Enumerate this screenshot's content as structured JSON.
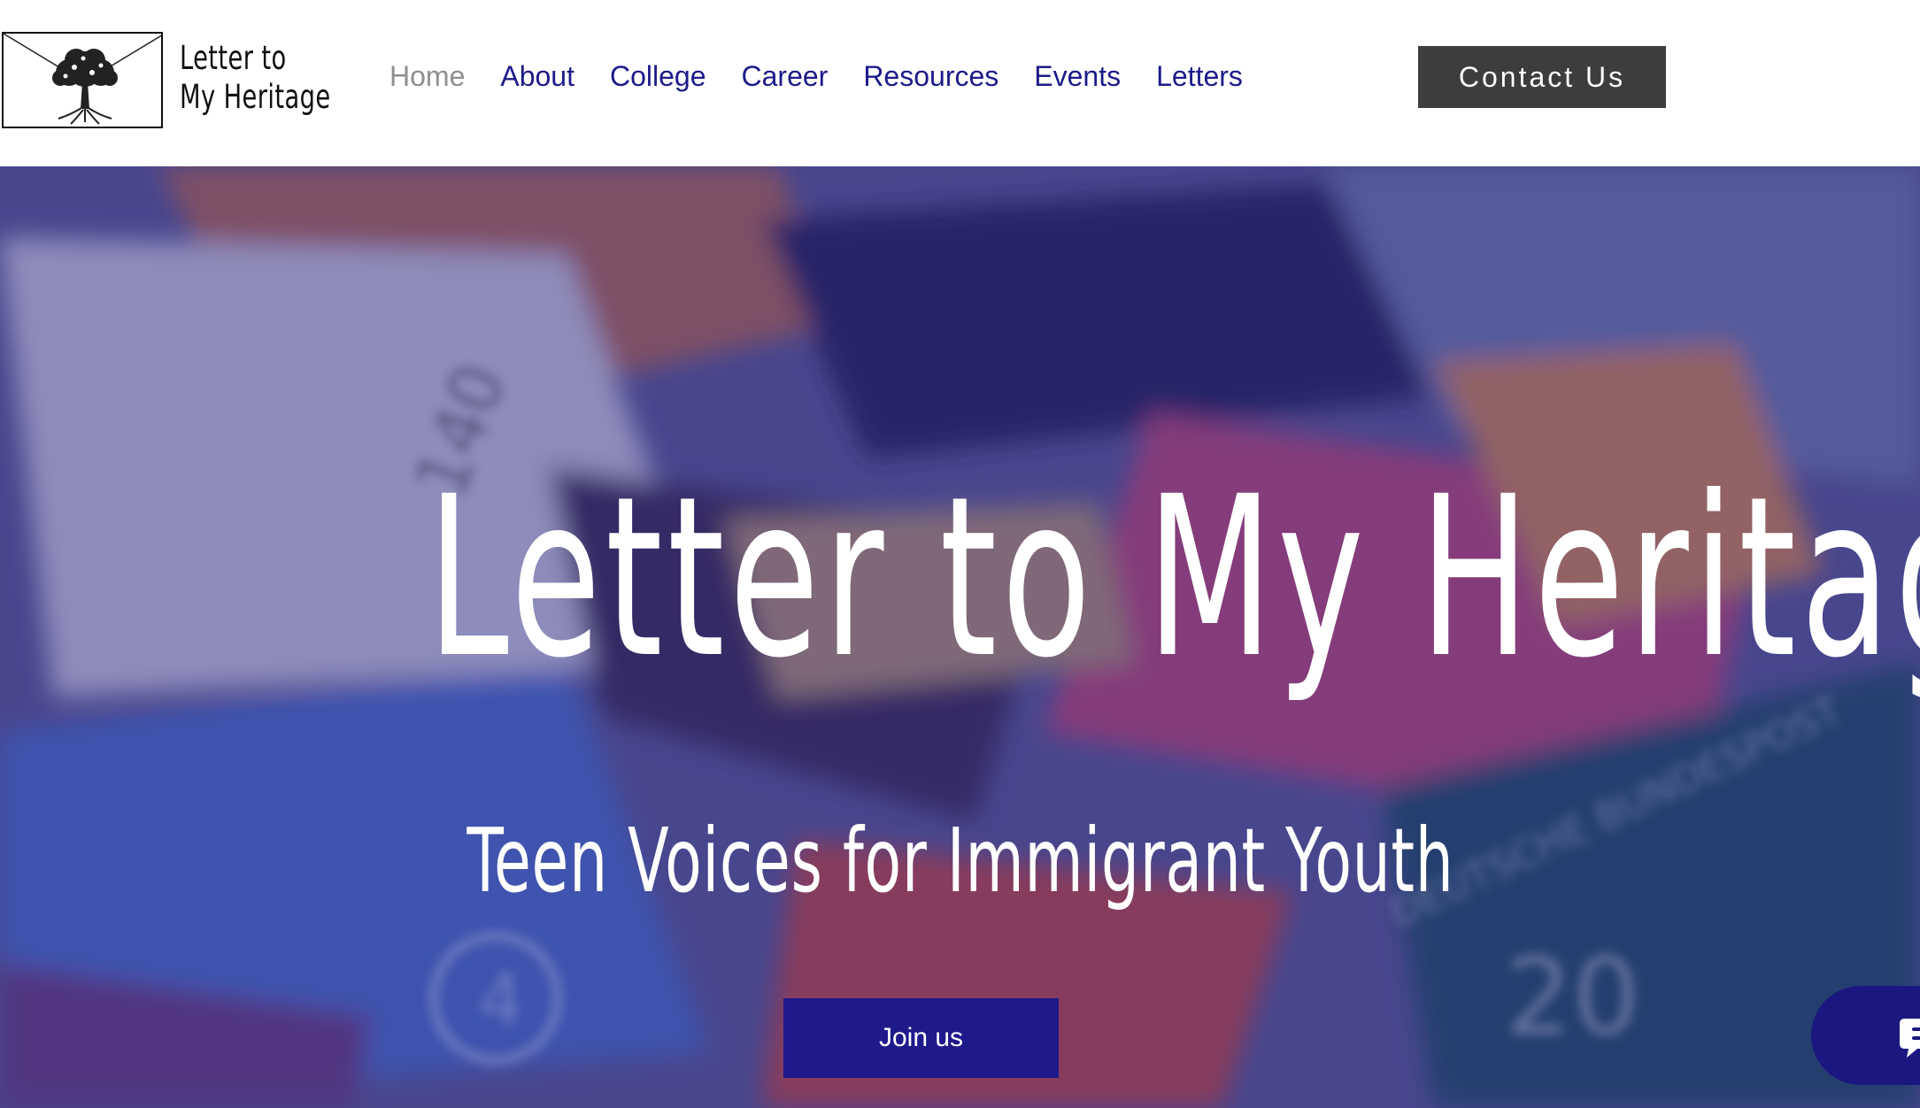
{
  "header": {
    "logo_line1": "Letter to",
    "logo_line2": "My Heritage",
    "nav": [
      {
        "label": "Home",
        "active": true
      },
      {
        "label": "About",
        "active": false
      },
      {
        "label": "College",
        "active": false
      },
      {
        "label": "Career",
        "active": false
      },
      {
        "label": "Resources",
        "active": false
      },
      {
        "label": "Events",
        "active": false
      },
      {
        "label": "Letters",
        "active": false
      }
    ],
    "contact_label": "Contact Us"
  },
  "hero": {
    "title": "Letter to My Heritage",
    "subtitle": "Teen Voices for Immigrant Youth",
    "join_label": "Join us",
    "chat_icon": "chat-bubble-icon"
  },
  "colors": {
    "nav_text": "#1c1b8a",
    "nav_active": "#8f8f8f",
    "contact_bg": "#3d3d3d",
    "join_bg": "#1e1a8c",
    "overlay": "#302a8c"
  }
}
